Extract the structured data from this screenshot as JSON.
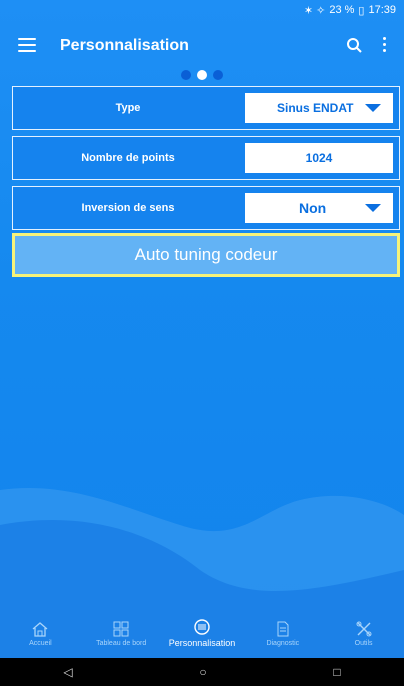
{
  "status": {
    "icons": "✶ ✧",
    "battery": "23 %",
    "time": "17:39"
  },
  "app": {
    "title": "Personnalisation"
  },
  "pager": {
    "pages": 3,
    "active_index": 1
  },
  "rows": [
    {
      "label": "Type",
      "value": "Sinus ENDAT",
      "dropdown": true
    },
    {
      "label": "Nombre de points",
      "value": "1024",
      "dropdown": false
    },
    {
      "label": "Inversion de sens",
      "value": "Non",
      "dropdown": true
    }
  ],
  "action": {
    "label": "Auto tuning codeur"
  },
  "bottom_nav": [
    {
      "label": "Accueil",
      "icon": "home-icon"
    },
    {
      "label": "Tableau de bord",
      "icon": "dashboard-icon"
    },
    {
      "label": "Personnalisation",
      "icon": "tune-icon",
      "active": true
    },
    {
      "label": "Diagnostic",
      "icon": "document-icon"
    },
    {
      "label": "Outils",
      "icon": "tools-icon"
    }
  ],
  "system_nav": {
    "back": "◁",
    "home": "○",
    "recent": "□"
  },
  "colors": {
    "accent": "#1583ee",
    "highlight": "#f6f37a",
    "button": "#63b3f5"
  }
}
